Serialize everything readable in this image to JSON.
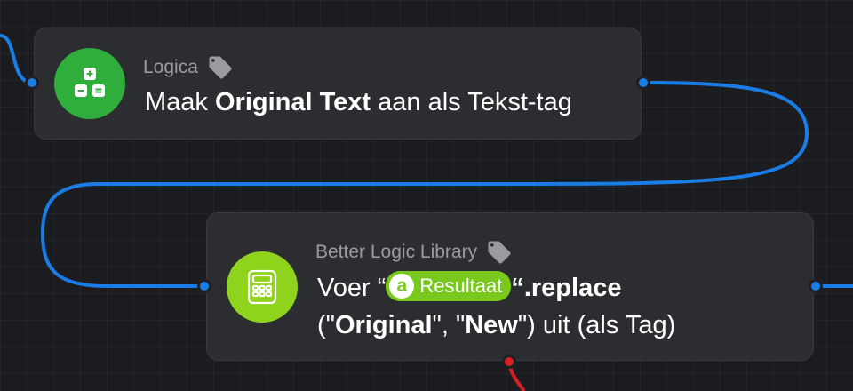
{
  "colors": {
    "wire": "#1a7de6",
    "error_wire": "#d81f26",
    "logic_icon_bg": "#2fae3c",
    "library_icon_bg": "#8ed31c",
    "tag_pill_bg": "#79c81e"
  },
  "nodes": [
    {
      "category": "Logica",
      "category_icon": "tag-icon",
      "icon": "logic-blocks-icon",
      "title_before": "Maak ",
      "title_bold": "Original Text",
      "title_after": " aan als Tekst-tag"
    },
    {
      "category": "Better Logic Library",
      "category_icon": "tag-icon",
      "icon": "calculator-icon",
      "title_before": "Voer “",
      "tag_avatar": "a",
      "tag_label": "Resultaat",
      "title_mid": "“.replace",
      "line2_p1": "(\"",
      "line2_b1": "Original",
      "line2_p2": "\", \"",
      "line2_b2": "New",
      "line2_p3": "\") uit (als Tag)"
    }
  ]
}
